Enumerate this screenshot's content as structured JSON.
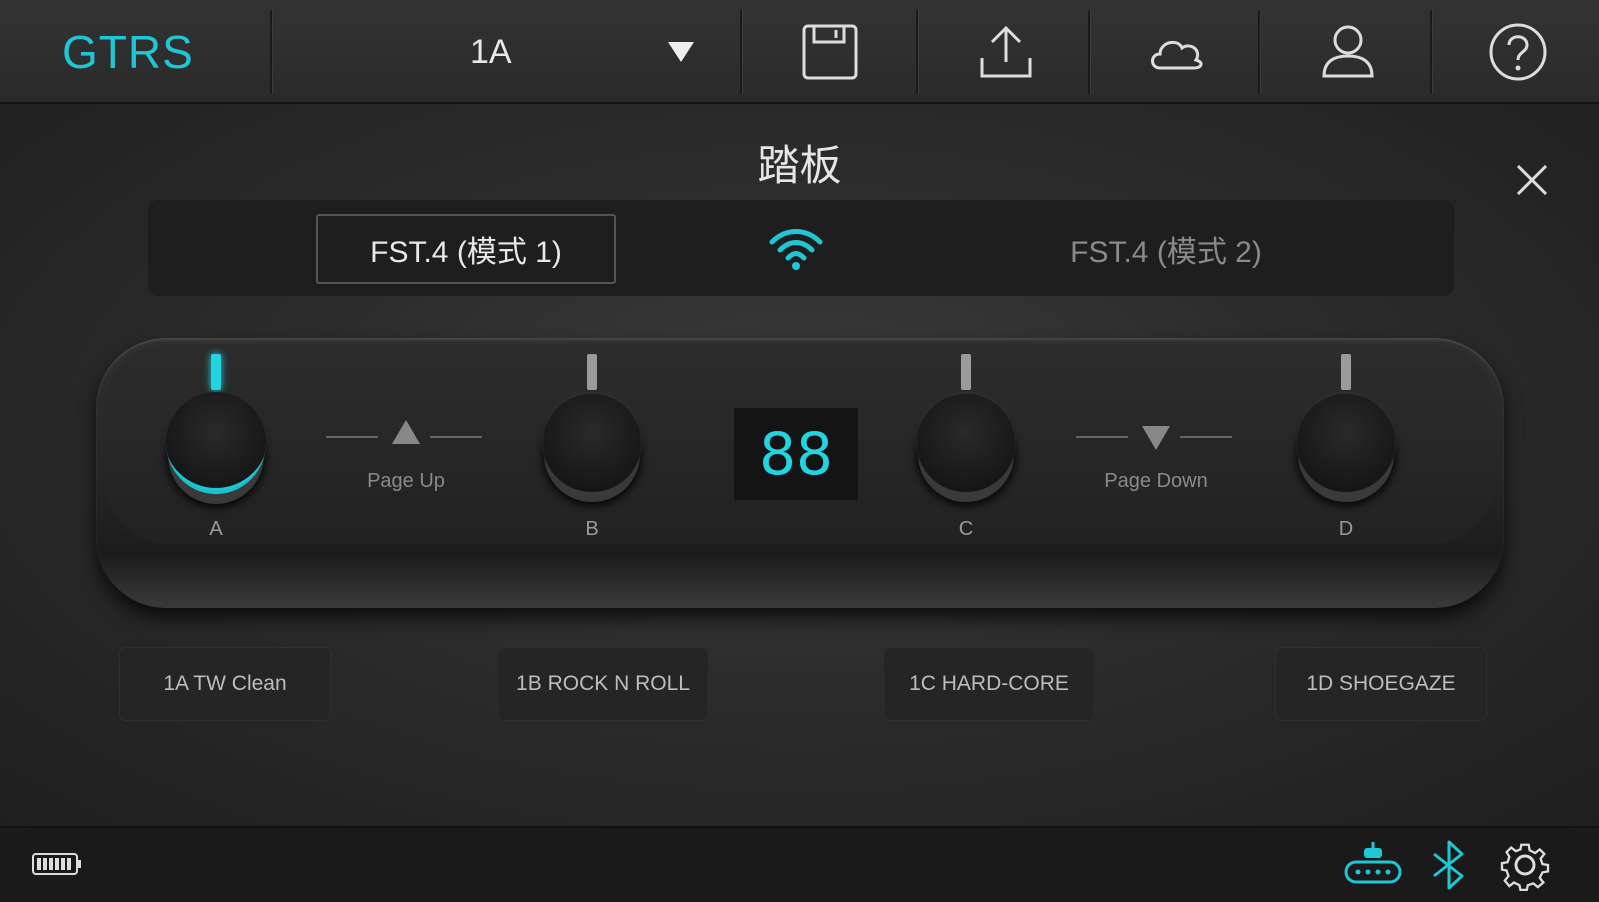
{
  "app": {
    "logo": "GTRS"
  },
  "toolbar": {
    "preset": "1A",
    "icons": [
      "save-icon",
      "upload-icon",
      "cloud-icon",
      "user-icon",
      "help-icon"
    ]
  },
  "panel": {
    "title": "踏板",
    "modes": {
      "mode1": "FST.4 (模式 1)",
      "mode2": "FST.4 (模式 2)"
    },
    "display": "88",
    "switches": [
      "A",
      "B",
      "C",
      "D"
    ],
    "page_up": "Page Up",
    "page_down": "Page Down",
    "presets": [
      "1A TW Clean",
      "1B ROCK N ROLL",
      "1C HARD-CORE",
      "1D SHOEGAZE"
    ]
  },
  "colors": {
    "accent": "#1fc6d4",
    "background": "#262626",
    "bar": "#1a1a1a"
  },
  "statusbar": {
    "icons": [
      "battery-icon",
      "pedal-device-icon",
      "bluetooth-icon",
      "gear-icon"
    ]
  }
}
